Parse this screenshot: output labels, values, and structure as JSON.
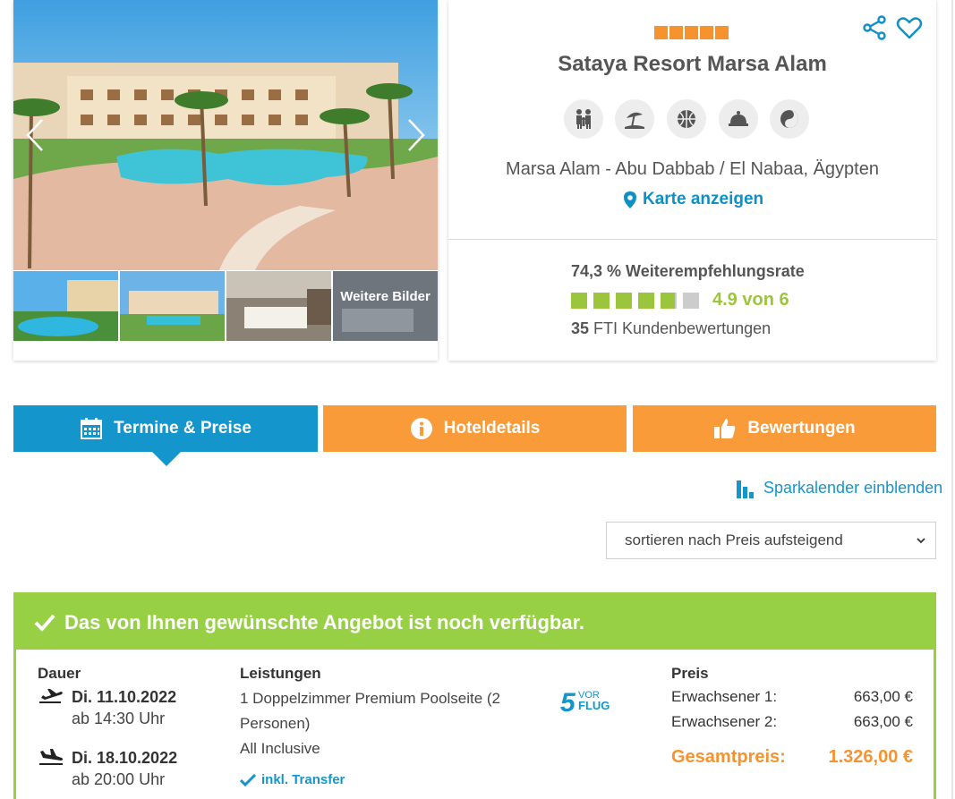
{
  "gallery": {
    "more_label": "Weitere Bilder",
    "prev_icon": "chevron-left-icon",
    "next_icon": "chevron-right-icon"
  },
  "hotel": {
    "stars": 5,
    "name": "Sataya Resort Marsa Alam",
    "location": "Marsa Alam - Abu Dabbab / El Nabaa, Ägypten",
    "map_link": "Karte anzeigen",
    "amenities": [
      "family-icon",
      "beach-icon",
      "sports-ball-icon",
      "restaurant-cloche-icon",
      "wellness-icon"
    ],
    "recommendation": "74,3 % Weiterempfehlungsrate",
    "rating": {
      "value": 4.9,
      "max": 6,
      "text": "4.9 von 6"
    },
    "reviews_count": "35",
    "reviews_label": "FTI Kundenbewertungen",
    "accent_color": "#0e8fc6",
    "star_color": "#f7932f",
    "rating_color": "#9bc53d"
  },
  "tabs": [
    {
      "label": "Termine & Preise",
      "icon": "calendar-icon",
      "active": true
    },
    {
      "label": "Hoteldetails",
      "icon": "info-icon",
      "active": false
    },
    {
      "label": "Bewertungen",
      "icon": "thumbs-up-icon",
      "active": false
    }
  ],
  "spar_link": "Sparkalender einblenden",
  "sort": {
    "selected": "sortieren nach Preis aufsteigend"
  },
  "offer": {
    "banner": "Das von Ihnen gewünschte Angebot ist noch verfügbar.",
    "duration_header": "Dauer",
    "outbound": {
      "date": "Di. 11.10.2022",
      "time": "ab 14:30 Uhr"
    },
    "return": {
      "date": "Di. 18.10.2022",
      "time": "ab 20:00 Uhr"
    },
    "services_header": "Leistungen",
    "room": "1 Doppelzimmer Premium Poolseite (2 Personen)",
    "board": "All Inclusive",
    "transfer": "inkl. Transfer",
    "badge": {
      "number": "5",
      "line1": "VOR",
      "line2": "FLUG"
    },
    "price_header": "Preis",
    "prices": [
      {
        "label": "Erwachsener 1:",
        "amount": "663,00 €"
      },
      {
        "label": "Erwachsener 2:",
        "amount": "663,00 €"
      }
    ],
    "total_label": "Gesamtpreis:",
    "total_amount": "1.326,00 €"
  }
}
